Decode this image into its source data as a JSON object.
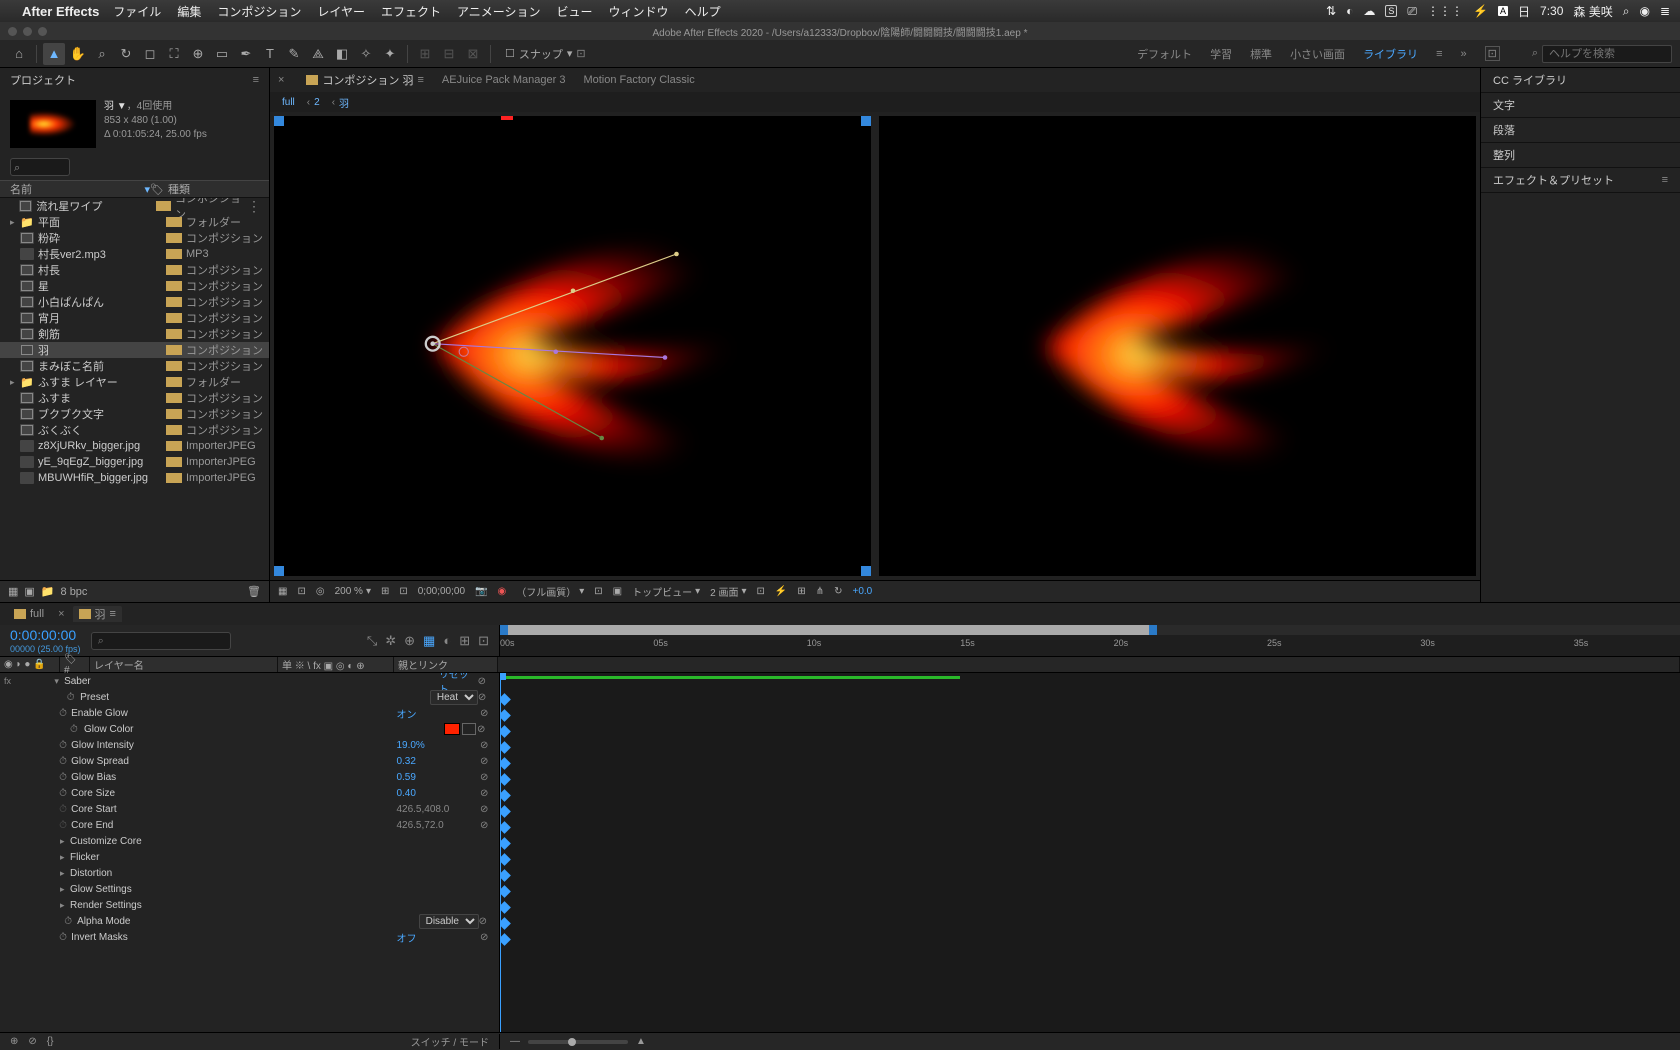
{
  "menubar": {
    "app": "After Effects",
    "menus": [
      "ファイル",
      "編集",
      "コンポジション",
      "レイヤー",
      "エフェクト",
      "アニメーション",
      "ビュー",
      "ウィンドウ",
      "ヘルプ"
    ],
    "right": {
      "day": "日",
      "time": "7:30",
      "user": "森 美咲"
    }
  },
  "title": "Adobe After Effects 2020 - /Users/a12333/Dropbox/陰陽師/闘闘闘技/闘闘闘技1.aep *",
  "toolbar": {
    "snap_label": "スナップ",
    "workspaces": [
      "デフォルト",
      "学習",
      "標準",
      "小さい画面",
      "ライブラリ"
    ],
    "help_placeholder": "ヘルプを検索"
  },
  "project": {
    "panel": "プロジェクト",
    "comp_name": "羽 ▼",
    "comp_uses": "，4回使用",
    "dims": "853 x 480 (1.00)",
    "duration": "Δ 0:01:05:24, 25.00 fps",
    "col_name": "名前",
    "col_type": "種類",
    "items": [
      {
        "arrow": "",
        "icon": "comp",
        "name": "流れ星ワイプ",
        "type": "コンポジション",
        "extra": "⋮"
      },
      {
        "arrow": "▸",
        "icon": "folder",
        "name": "平面",
        "type": "フォルダー"
      },
      {
        "arrow": "",
        "icon": "comp",
        "name": "粉砕",
        "type": "コンポジション"
      },
      {
        "arrow": "",
        "icon": "file",
        "name": "村長ver2.mp3",
        "type": "MP3"
      },
      {
        "arrow": "",
        "icon": "comp",
        "name": "村長",
        "type": "コンポジション"
      },
      {
        "arrow": "",
        "icon": "comp",
        "name": "星",
        "type": "コンポジション"
      },
      {
        "arrow": "",
        "icon": "comp",
        "name": "小白ぱんぱん",
        "type": "コンポジション"
      },
      {
        "arrow": "",
        "icon": "comp",
        "name": "宵月",
        "type": "コンポジション"
      },
      {
        "arrow": "",
        "icon": "comp",
        "name": "剣筋",
        "type": "コンポジション"
      },
      {
        "arrow": "",
        "icon": "comp",
        "name": "羽",
        "type": "コンポジション",
        "selected": true
      },
      {
        "arrow": "",
        "icon": "comp",
        "name": "まみぼこ名前",
        "type": "コンポジション"
      },
      {
        "arrow": "▸",
        "icon": "folder",
        "name": "ふすま レイヤー",
        "type": "フォルダー"
      },
      {
        "arrow": "",
        "icon": "comp",
        "name": "ふすま",
        "type": "コンポジション"
      },
      {
        "arrow": "",
        "icon": "comp",
        "name": "ブクブク文字",
        "type": "コンポジション"
      },
      {
        "arrow": "",
        "icon": "comp",
        "name": "ぶくぶく",
        "type": "コンポジション"
      },
      {
        "arrow": "",
        "icon": "file",
        "name": "z8XjURkv_bigger.jpg",
        "type": "ImporterJPEG"
      },
      {
        "arrow": "",
        "icon": "file",
        "name": "yE_9qEgZ_bigger.jpg",
        "type": "ImporterJPEG"
      },
      {
        "arrow": "",
        "icon": "file",
        "name": "MBUWHfiR_bigger.jpg",
        "type": "ImporterJPEG"
      }
    ],
    "bpc": "8 bpc"
  },
  "comp_tabs": [
    "コンポジション 羽",
    "AEJuice Pack Manager 3",
    "Motion Factory Classic"
  ],
  "breadcrumb": [
    "full",
    "2",
    "羽"
  ],
  "viewer_footer": {
    "zoom": "200 %",
    "time": "0;00;00;00",
    "quality": "（フル画質）",
    "view": "トップビュー",
    "views": "2 画面",
    "exposure": "+0.0"
  },
  "right_panels": [
    "CC ライブラリ",
    "文字",
    "段落",
    "整列",
    "エフェクト＆プリセット"
  ],
  "timeline": {
    "tabs": [
      "full",
      "羽"
    ],
    "time": "0:00:00:00",
    "time_sub": "00000 (25.00 fps)",
    "col_labels": {
      "layer": "レイヤー名",
      "switches": "单 ※ \\ fx ▣ ◎ ◐ ⊕",
      "parent": "親とリンク"
    },
    "ticks": [
      "00s",
      "05s",
      "10s",
      "15s",
      "20s",
      "25s",
      "30s",
      "35s"
    ],
    "props": [
      {
        "indent": 1,
        "arrow": "▾",
        "name": "Saber",
        "reset": "リセット",
        "link": true,
        "fx": true
      },
      {
        "indent": 2,
        "sw": true,
        "name": "Preset",
        "val": "Heat",
        "type": "select",
        "link": true
      },
      {
        "indent": 2,
        "sw": true,
        "name": "Enable Glow",
        "val": "オン",
        "blue": true,
        "link": true
      },
      {
        "indent": 2,
        "sw": true,
        "name": "Glow Color",
        "val": "#ff2200",
        "type": "color",
        "link": true
      },
      {
        "indent": 2,
        "sw": true,
        "name": "Glow Intensity",
        "val": "19.0%",
        "blue": true,
        "link": true
      },
      {
        "indent": 2,
        "sw": true,
        "name": "Glow Spread",
        "val": "0.32",
        "blue": true,
        "link": true
      },
      {
        "indent": 2,
        "sw": true,
        "name": "Glow Bias",
        "val": "0.59",
        "blue": true,
        "link": true
      },
      {
        "indent": 2,
        "sw": true,
        "name": "Core Size",
        "val": "0.40",
        "blue": true,
        "link": true
      },
      {
        "indent": 2,
        "sw": false,
        "name": "Core Start",
        "val": "426.5,408.0",
        "gray": true,
        "link": true
      },
      {
        "indent": 2,
        "sw": false,
        "name": "Core End",
        "val": "426.5,72.0",
        "gray": true,
        "link": true
      },
      {
        "indent": 2,
        "arrow": "▸",
        "name": "Customize Core"
      },
      {
        "indent": 2,
        "arrow": "▸",
        "name": "Flicker"
      },
      {
        "indent": 2,
        "arrow": "▸",
        "name": "Distortion"
      },
      {
        "indent": 2,
        "arrow": "▸",
        "name": "Glow Settings"
      },
      {
        "indent": 2,
        "arrow": "▸",
        "name": "Render Settings"
      },
      {
        "indent": 2,
        "sw": true,
        "name": "Alpha Mode",
        "val": "Disable",
        "type": "select",
        "link": true
      },
      {
        "indent": 2,
        "sw": true,
        "name": "Invert Masks",
        "val": "オフ",
        "blue": true,
        "link": true
      }
    ],
    "footer_label": "スイッチ / モード"
  }
}
